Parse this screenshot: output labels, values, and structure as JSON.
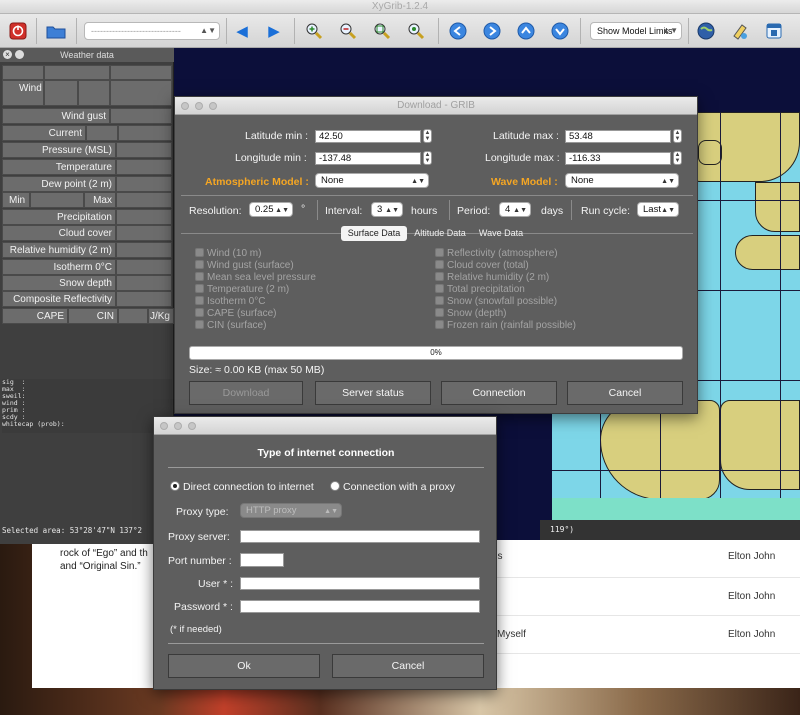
{
  "app": {
    "title": "XyGrib-1.2.4"
  },
  "toolbar": {
    "file_combo_value": "------------------------------",
    "model_limits_label": "Show Model Limits",
    "icons": [
      "quit-icon",
      "open-folder-icon",
      "prev-arrow-icon",
      "next-arrow-icon",
      "zoom-in-icon",
      "zoom-out-icon",
      "zoom-fit-icon",
      "zoom-select-icon",
      "left-circle-icon",
      "right-circle-icon",
      "up-circle-icon",
      "down-circle-icon",
      "globe-icon",
      "paint-icon",
      "window-icon"
    ]
  },
  "weather_panel": {
    "title": "Weather data",
    "rows": {
      "wind": "Wind",
      "wind_gust": "Wind gust",
      "current": "Current",
      "pressure": "Pressure (MSL)",
      "temperature": "Temperature",
      "dew_point": "Dew point (2 m)",
      "min": "Min",
      "max": "Max",
      "precipitation": "Precipitation",
      "cloud_cover": "Cloud cover",
      "humidity": "Relative humidity (2 m)",
      "isotherm": "Isotherm 0°C",
      "snow_depth": "Snow depth",
      "reflectivity": "Composite Reflectivity",
      "cape": "CAPE",
      "cin": "CIN",
      "unit": "J/Kg"
    },
    "text_lines": "sig  :\nmax  :\nsweil:\nwind :\nprim :\nscdy :\nwhitecap (prob):",
    "selected_area": "Selected area:  53°28'47\"N  137°2",
    "map_status_tail": "119°)"
  },
  "download": {
    "title": "Download - GRIB",
    "lat_min_label": "Latitude min :",
    "lat_min_value": "42.50",
    "lat_max_label": "Latitude max :",
    "lat_max_value": "53.48",
    "lon_min_label": "Longitude min :",
    "lon_min_value": "-137.48",
    "lon_max_label": "Longitude max :",
    "lon_max_value": "-116.33",
    "atm_model_label": "Atmospheric Model :",
    "atm_model_value": "None",
    "wave_model_label": "Wave Model :",
    "wave_model_value": "None",
    "resolution_label": "Resolution:",
    "resolution_value": "0.25",
    "resolution_unit": "°",
    "interval_label": "Interval:",
    "interval_value": "3",
    "interval_unit": "hours",
    "period_label": "Period:",
    "period_value": "4",
    "period_unit": "days",
    "run_cycle_label": "Run cycle:",
    "run_cycle_value": "Last",
    "tabs": [
      "Surface Data",
      "Altitude Data",
      "Wave Data"
    ],
    "left_checks": [
      "Wind (10 m)",
      "Wind gust (surface)",
      "Mean sea level pressure",
      "Temperature (2 m)",
      "Isotherm 0°C",
      "CAPE (surface)",
      "CIN (surface)"
    ],
    "right_checks": [
      "Reflectivity (atmosphere)",
      "Cloud cover (total)",
      "Relative humidity (2 m)",
      "Total precipitation",
      "Snow (snowfall possible)",
      "Snow (depth)",
      "Frozen rain (rainfall possible)"
    ],
    "progress_text": "0%",
    "progress": 0,
    "size_text": "Size: ≈ 0.00 KB (max 50 MB)",
    "buttons": {
      "download": "Download",
      "server_status": "Server status",
      "connection": "Connection",
      "cancel": "Cancel"
    }
  },
  "connection": {
    "title": "Type of internet connection",
    "direct_label": "Direct connection to internet",
    "proxy_label": "Connection with a proxy",
    "proxy_type_label": "Proxy type:",
    "proxy_type_value": "HTTP proxy",
    "proxy_server_label": "Proxy server:",
    "port_label": "Port number :",
    "user_label": "User * :",
    "password_label": "Password * :",
    "note": "(* if needed)",
    "ok": "Ok",
    "cancel": "Cancel"
  },
  "webpage": {
    "text_line1": "rock of “Ego” and th",
    "text_line2": "and “Original Sin.”",
    "rows": [
      {
        "title": "rls",
        "artist": "Elton John"
      },
      {
        "title": "",
        "artist": "Elton John"
      },
      {
        "title": "l Myself",
        "artist": "Elton John"
      }
    ]
  }
}
